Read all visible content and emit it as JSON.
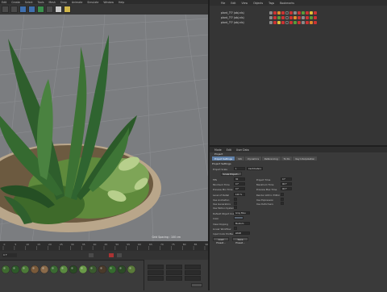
{
  "menubar": {
    "items": [
      "Edit",
      "Create",
      "Select",
      "Tools",
      "Mesh",
      "Snap",
      "Animate",
      "Simulate",
      "Window",
      "Help"
    ]
  },
  "viewport": {
    "info": "Grid Spacing : 100 cm"
  },
  "timeline": {
    "ticks": [
      "0",
      "5",
      "10",
      "15",
      "20",
      "25",
      "30",
      "35",
      "40",
      "45",
      "50",
      "55",
      "60",
      "65",
      "70",
      "75",
      "80",
      "85",
      "90"
    ],
    "frame": "0 F"
  },
  "object_manager": {
    "menu": [
      "File",
      "Edit",
      "View",
      "Objects",
      "Tags",
      "Bookmarks"
    ],
    "objects": [
      "plant_??? (obj.nls)",
      "plant_??? (obj.nls)",
      "plant_??? (obj.nls)"
    ]
  },
  "attribute_manager": {
    "menu": [
      "Mode",
      "Edit",
      "User Data"
    ],
    "title": "Project",
    "tabs": [
      "Project Settings",
      "Info",
      "Dynamics",
      "Referencing",
      "To Do",
      "Key Interpolation"
    ],
    "section": "Project Settings",
    "fields": {
      "scale_label": "Project Scale",
      "scale_value": "1",
      "scale_unit": "Centimeters",
      "scale_btn": "Scale Project...",
      "fps_label": "FPS",
      "fps_value": "30",
      "project_time_label": "Project Time",
      "project_time_value": "0 F",
      "min_time_label": "Minimum Time",
      "min_time_value": "0 F",
      "max_time_label": "Maximum Time",
      "max_time_value": "90 F",
      "preview_min_label": "Preview Min Time",
      "preview_min_value": "0 F",
      "preview_max_label": "Preview Max Time",
      "preview_max_value": "90 F",
      "lod_label": "Level of Detail",
      "lod_value": "100 %",
      "render_lod_label": "Render LOD in Editor",
      "use_animation_label": "Use Animation",
      "use_expression_label": "Use Expression",
      "use_generators_label": "Use Generators",
      "use_deformers_label": "Use Deformers",
      "use_motion_label": "Use Motion System",
      "default_color_label": "Default Object Color",
      "default_color_value": "Gray Blue",
      "color_label": "Color",
      "view_clipping_label": "View Clipping",
      "view_clipping_value": "Medium",
      "linear_workflow_label": "Linear Workflow",
      "input_color_label": "Input Color Profile",
      "input_color_value": "sRGB",
      "load_preset_btn": "Load Preset...",
      "save_preset_btn": "Save Preset..."
    }
  },
  "colors": {
    "accent_tab": "#5e7fa8",
    "viewport_bg": "#7b7d80",
    "panel_bg": "#353535"
  }
}
